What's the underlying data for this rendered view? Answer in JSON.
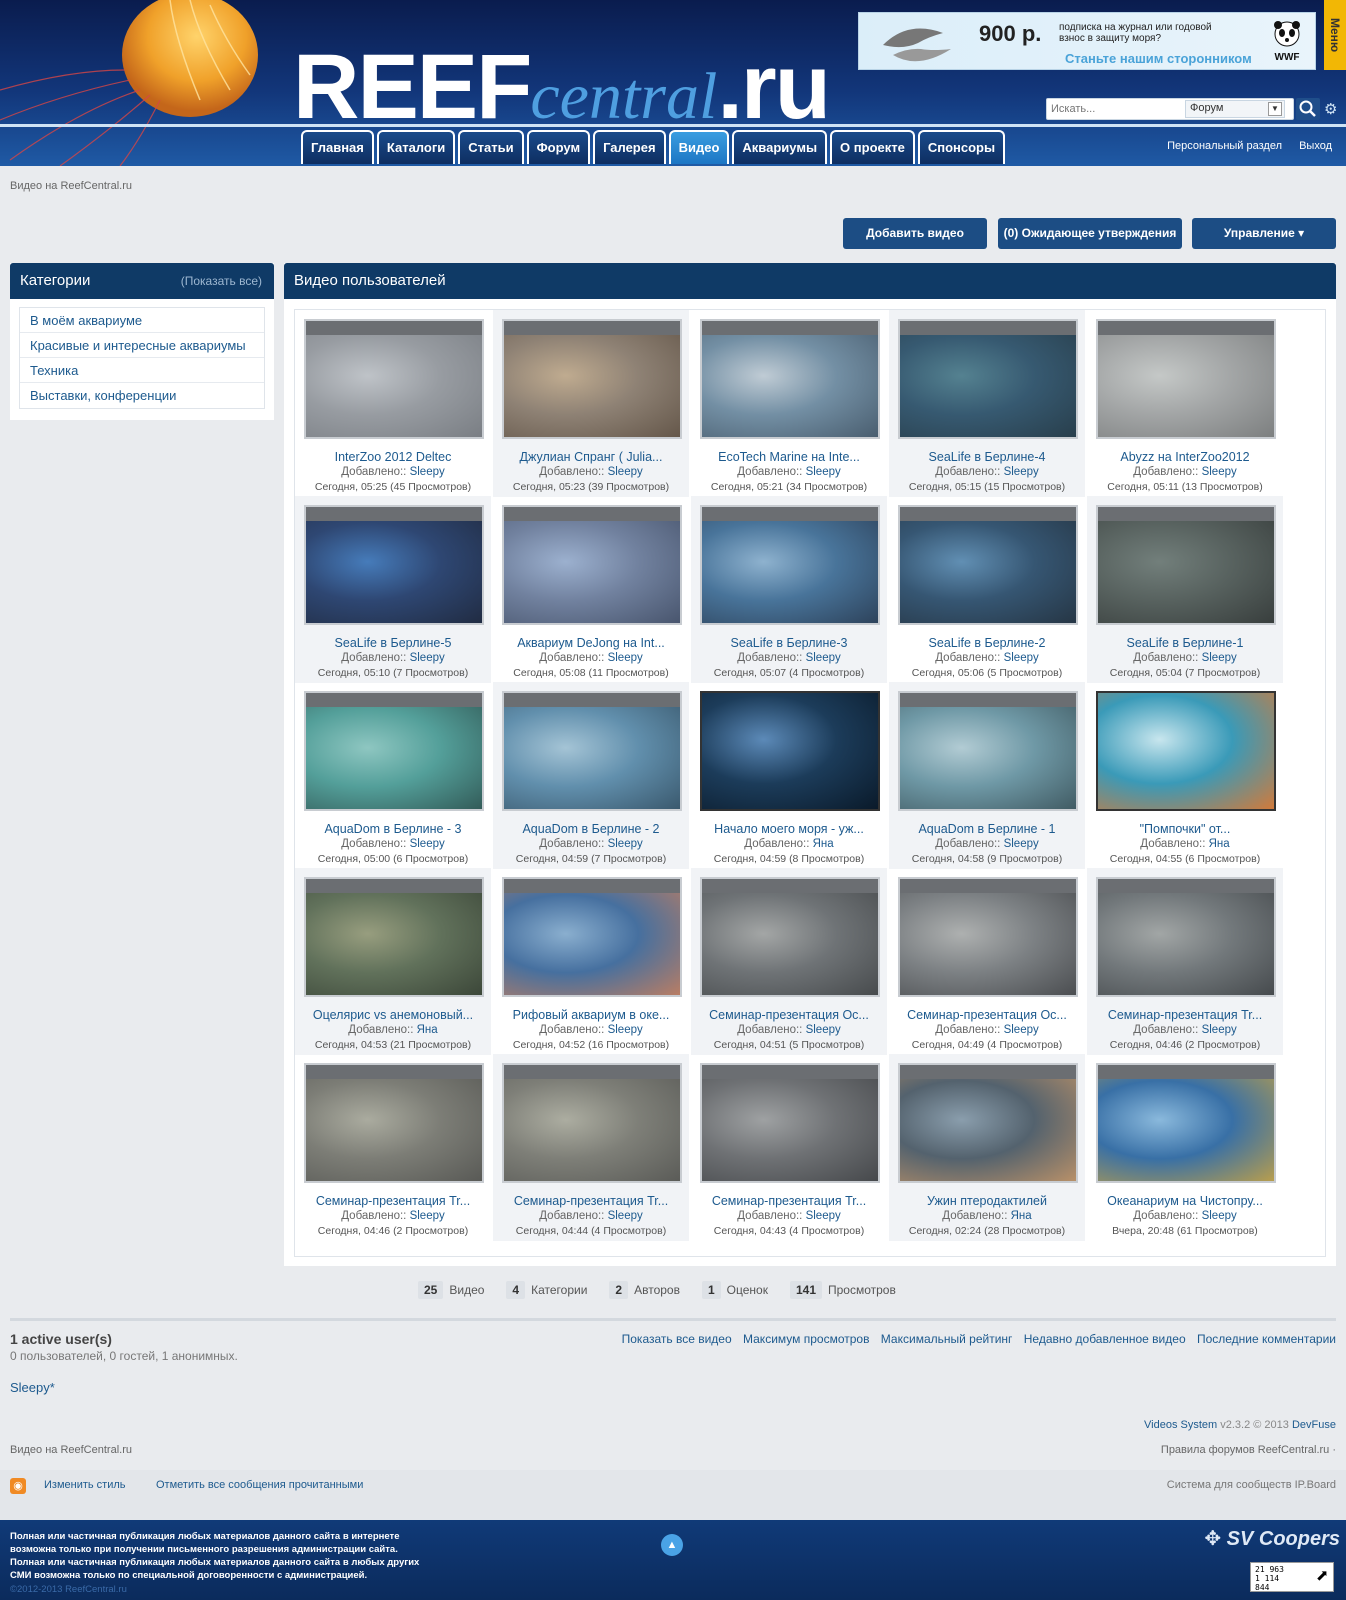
{
  "header": {
    "logo_main": "REEF",
    "logo_central": "central",
    "logo_ru": ".ru",
    "ad": {
      "price": "900 р.",
      "sub": "подписка на журнал или годовой взнос в защиту моря?",
      "cta": "Станьте нашим сторонником",
      "brand": "WWF"
    },
    "menu_tab": "Меню",
    "search_placeholder": "Искать...",
    "search_scope": "Форум",
    "nav": [
      "Главная",
      "Каталоги",
      "Статьи",
      "Форум",
      "Галерея",
      "Видео",
      "Аквариумы",
      "О проекте",
      "Спонсоры"
    ],
    "nav_active": "Видео",
    "user_links": [
      "Персональный раздел",
      "Выход"
    ]
  },
  "breadcrumb": "Видео на ReefCentral.ru",
  "actions": {
    "add": "Добавить видео",
    "pending": "(0) Ожидающее утверждения",
    "manage": "Управление ▾"
  },
  "sidebar": {
    "title": "Категории",
    "show_all": "(Показать все)",
    "categories": [
      "В моём аквариуме",
      "Красивые и интересные аквариумы",
      "Техника",
      "Выставки, конференции"
    ]
  },
  "main": {
    "title": "Видео пользователей",
    "added_label": "Добавлено::",
    "videos": [
      {
        "title": "InterZoo 2012 Deltec",
        "author": "Sleepy",
        "meta": "Сегодня, 05:25 (45 Просмотров)"
      },
      {
        "title": "Джулиан Спранг ( Julia...",
        "author": "Sleepy",
        "meta": "Сегодня, 05:23 (39 Просмотров)"
      },
      {
        "title": "EcoTech Marine на Inte...",
        "author": "Sleepy",
        "meta": "Сегодня, 05:21 (34 Просмотров)"
      },
      {
        "title": "SeaLife в Берлине-4",
        "author": "Sleepy",
        "meta": "Сегодня, 05:15 (15 Просмотров)"
      },
      {
        "title": "Abyzz на InterZoo2012",
        "author": "Sleepy",
        "meta": "Сегодня, 05:11 (13 Просмотров)"
      },
      {
        "title": "SeaLife в Берлине-5",
        "author": "Sleepy",
        "meta": "Сегодня, 05:10 (7 Просмотров)"
      },
      {
        "title": "Аквариум DeJong на Int...",
        "author": "Sleepy",
        "meta": "Сегодня, 05:08 (11 Просмотров)"
      },
      {
        "title": "SeaLife в Берлине-3",
        "author": "Sleepy",
        "meta": "Сегодня, 05:07 (4 Просмотров)"
      },
      {
        "title": "SeaLife в Берлине-2",
        "author": "Sleepy",
        "meta": "Сегодня, 05:06 (5 Просмотров)"
      },
      {
        "title": "SeaLife в Берлине-1",
        "author": "Sleepy",
        "meta": "Сегодня, 05:04 (7 Просмотров)"
      },
      {
        "title": "AquaDom в Берлине - 3",
        "author": "Sleepy",
        "meta": "Сегодня, 05:00 (6 Просмотров)"
      },
      {
        "title": "AquaDom в Берлине - 2",
        "author": "Sleepy",
        "meta": "Сегодня, 04:59 (7 Просмотров)"
      },
      {
        "title": "Начало моего моря - уж...",
        "author": "Яна",
        "meta": "Сегодня, 04:59 (8 Просмотров)"
      },
      {
        "title": "AquaDom в Берлине - 1",
        "author": "Sleepy",
        "meta": "Сегодня, 04:58 (9 Просмотров)"
      },
      {
        "title": "\"Помпочки\" от...",
        "author": "Яна",
        "meta": "Сегодня, 04:55 (6 Просмотров)"
      },
      {
        "title": "Оцелярис vs анемоновый...",
        "author": "Яна",
        "meta": "Сегодня, 04:53 (21 Просмотров)"
      },
      {
        "title": "Рифовый аквариум в оке...",
        "author": "Sleepy",
        "meta": "Сегодня, 04:52 (16 Просмотров)"
      },
      {
        "title": "Семинар-презентация Ос...",
        "author": "Sleepy",
        "meta": "Сегодня, 04:51 (5 Просмотров)"
      },
      {
        "title": "Семинар-презентация Ос...",
        "author": "Sleepy",
        "meta": "Сегодня, 04:49 (4 Просмотров)"
      },
      {
        "title": "Семинар-презентация Tr...",
        "author": "Sleepy",
        "meta": "Сегодня, 04:46 (2 Просмотров)"
      },
      {
        "title": "Семинар-презентация Tr...",
        "author": "Sleepy",
        "meta": "Сегодня, 04:46 (2 Просмотров)"
      },
      {
        "title": "Семинар-презентация Tr...",
        "author": "Sleepy",
        "meta": "Сегодня, 04:44 (4 Просмотров)"
      },
      {
        "title": "Семинар-презентация Tr...",
        "author": "Sleepy",
        "meta": "Сегодня, 04:43 (4 Просмотров)"
      },
      {
        "title": "Ужин птеродактилей",
        "author": "Яна",
        "meta": "Сегодня, 02:24 (28 Просмотров)"
      },
      {
        "title": "Океанариум на Чистопру...",
        "author": "Sleepy",
        "meta": "Вчера, 20:48 (61 Просмотров)"
      }
    ]
  },
  "stats": [
    {
      "num": "25",
      "label": "Видео"
    },
    {
      "num": "4",
      "label": "Категории"
    },
    {
      "num": "2",
      "label": "Авторов"
    },
    {
      "num": "1",
      "label": "Оценок"
    },
    {
      "num": "141",
      "label": "Просмотров"
    }
  ],
  "active": {
    "title": "1 active user(s)",
    "sub": "0 пользователей, 0 гостей, 1 анонимных.",
    "name": "Sleepy*"
  },
  "bottom_links": [
    "Показать все видео",
    "Максимум просмотров",
    "Максимальный рейтинг",
    "Недавно добавленное видео",
    "Последние комментарии"
  ],
  "credit": {
    "system": "Videos System",
    "version": "v2.3.2 © 2013",
    "vendor": "DevFuse"
  },
  "footer": {
    "crumb": "Видео на ReefCentral.ru",
    "rules": "Правила форумов ReefCentral.ru ·",
    "change_style": "Изменить стиль",
    "mark_read": "Отметить все сообщения прочитанными",
    "ipboard": "Система для сообществ IP.Board",
    "disclaimer": "Полная или частичная публикация любых материалов данного сайта в интернете возможна только при получении письменного разрешения администрации сайта. Полная или частичная публикация любых материалов данного сайта в любых других СМИ возможна только по специальной договоренности с администрацией.",
    "copyright": "©2012-2013 ReefCentral.ru",
    "partner": "SV Coopers",
    "counter": [
      "21 963",
      "1 114",
      "844"
    ]
  },
  "colors": {
    "header_dark": "#0a1c4e",
    "nav_active": "#2a8ad6",
    "panel_head": "#0f3a66",
    "link": "#1d5a8e",
    "button": "#1c4d84"
  }
}
